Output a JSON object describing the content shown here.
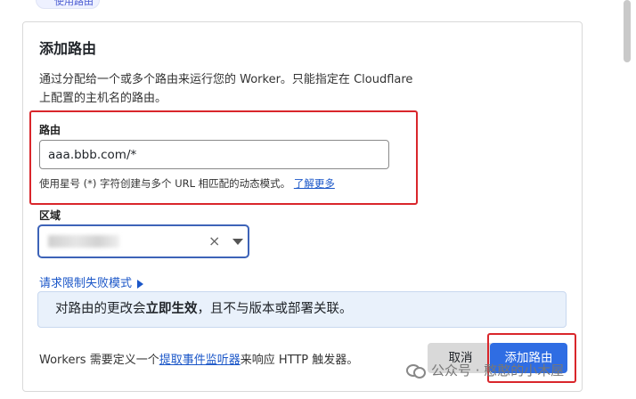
{
  "tab_chip": "使用路由",
  "panel": {
    "title": "添加路由",
    "description": "通过分配给一个或多个路由来运行您的 Worker。只能指定在 Cloudflare 上配置的主机名的路由。"
  },
  "route": {
    "label": "路由",
    "value": "aaa.bbb.com/*",
    "help_text": "使用星号 (*) 字符创建与多个 URL 相匹配的动态模式。",
    "help_link": "了解更多"
  },
  "zone": {
    "label": "区域",
    "clear_symbol": "×"
  },
  "fail_mode_link": "请求限制失败模式",
  "notice": {
    "before": "对路由的更改会",
    "bold": "立即生效",
    "after": "，且不与版本或部署关联。"
  },
  "footer": {
    "before": "Workers 需要定义一个",
    "link": "提取事件监听器",
    "after": "来响应 HTTP 触发器。"
  },
  "buttons": {
    "cancel": "取消",
    "add": "添加路由"
  },
  "watermark": "公众号 · 憨憨的小木屋",
  "colors": {
    "accent": "#2f6de3",
    "highlight": "#d9262b",
    "link": "#1a56c8",
    "notice_bg": "#e9f1fb"
  }
}
